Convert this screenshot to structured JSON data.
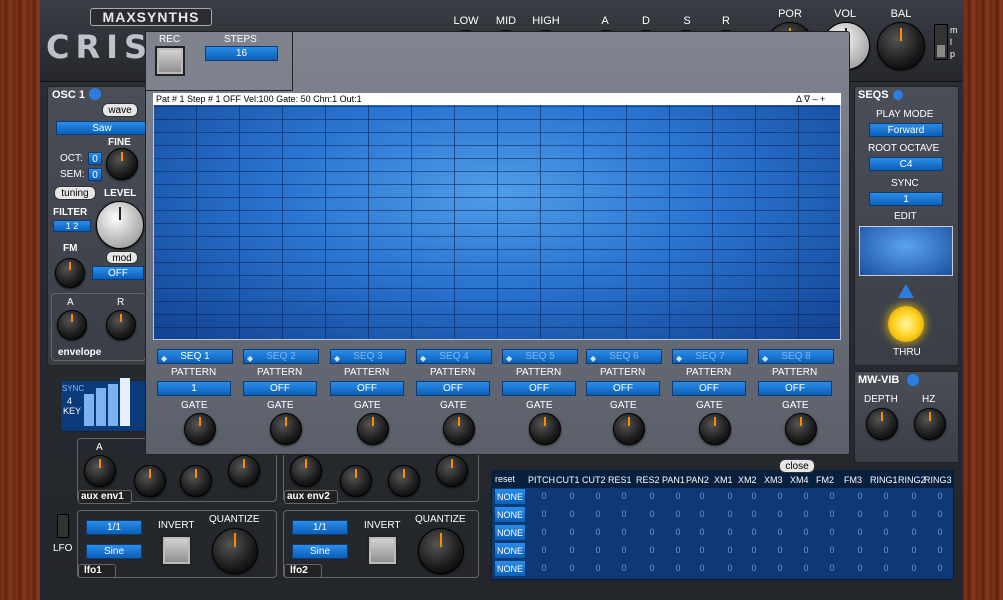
{
  "header": {
    "brand": "MAXSYNTHS",
    "title": "CRIS",
    "eq": [
      {
        "label": "LOW"
      },
      {
        "label": "MID"
      },
      {
        "label": "HIGH"
      }
    ],
    "env": [
      {
        "label": "A"
      },
      {
        "label": "D"
      },
      {
        "label": "S"
      },
      {
        "label": "R"
      }
    ],
    "master": [
      {
        "label": "POR"
      },
      {
        "label": "VOL"
      },
      {
        "label": "BAL"
      }
    ],
    "switch_labels": [
      "m",
      "l",
      "p"
    ]
  },
  "osc": {
    "title": "OSC 1",
    "wave_btn": "wave",
    "wave_value": "Saw",
    "fine_label": "FINE",
    "oct_label": "OCT:",
    "oct_value": "0",
    "sem_label": "SEM:",
    "sem_value": "0",
    "tuning_btn": "tuning",
    "level_label": "LEVEL",
    "filter_label": "FILTER",
    "filter_value": "1  2",
    "fm_label": "FM",
    "mod_btn": "mod",
    "mod_value": "OFF",
    "env_a": "A",
    "env_r": "R",
    "envelope_label": "envelope"
  },
  "seqs_panel": {
    "title": "SEQS",
    "play_mode_label": "PLAY MODE",
    "play_mode": "Forward",
    "root_label": "ROOT OCTAVE",
    "root": "C4",
    "sync_label": "SYNC",
    "sync": "1",
    "edit_label": "EDIT",
    "thru_label": "THRU"
  },
  "mwvib": {
    "title": "MW-VIB",
    "depth": "DEPTH",
    "hz": "HZ"
  },
  "popup": {
    "rec_label": "REC",
    "steps_label": "STEPS",
    "steps_value": "16",
    "grid_header": "Pat # 1 Step # 1  OFF Vel:100 Gate:  50 Chn:1 Out:1",
    "grid_controls": "Δ ∇ – +",
    "pattern_label": "PATTERN",
    "gate_label": "GATE",
    "close": "close",
    "seqs": [
      {
        "name": "SEQ 1",
        "pattern": "1",
        "active": true
      },
      {
        "name": "SEQ 2",
        "pattern": "OFF",
        "active": false
      },
      {
        "name": "SEQ 3",
        "pattern": "OFF",
        "active": false
      },
      {
        "name": "SEQ 4",
        "pattern": "OFF",
        "active": false
      },
      {
        "name": "SEQ 5",
        "pattern": "OFF",
        "active": false
      },
      {
        "name": "SEQ 6",
        "pattern": "OFF",
        "active": false
      },
      {
        "name": "SEQ 7",
        "pattern": "OFF",
        "active": false
      },
      {
        "name": "SEQ 8",
        "pattern": "OFF",
        "active": false
      }
    ]
  },
  "lower": {
    "sync_label": "SYNC",
    "sync_val": "4",
    "key_label": "KEY",
    "aux_env1": "aux env1",
    "aux_env2": "aux env2",
    "aux_a": "A",
    "lfo_label": "LFO",
    "lfo1": {
      "rate": "1/1",
      "shape": "Sine",
      "invert": "INVERT",
      "quantize": "QUANTIZE",
      "name": "lfo1"
    },
    "lfo2": {
      "rate": "1/1",
      "shape": "Sine",
      "invert": "INVERT",
      "quantize": "QUANTIZE",
      "name": "lfo2"
    }
  },
  "modmatrix": {
    "reset": "reset",
    "columns": [
      "PITCH",
      "CUT1",
      "CUT2",
      "RES1",
      "RES2",
      "PAN1",
      "PAN2",
      "XM1",
      "XM2",
      "XM3",
      "XM4",
      "FM2",
      "FM3",
      "RING1",
      "RING2",
      "RING3"
    ],
    "rows": [
      "NONE",
      "NONE",
      "NONE",
      "NONE",
      "NONE"
    ],
    "cell": "0"
  }
}
